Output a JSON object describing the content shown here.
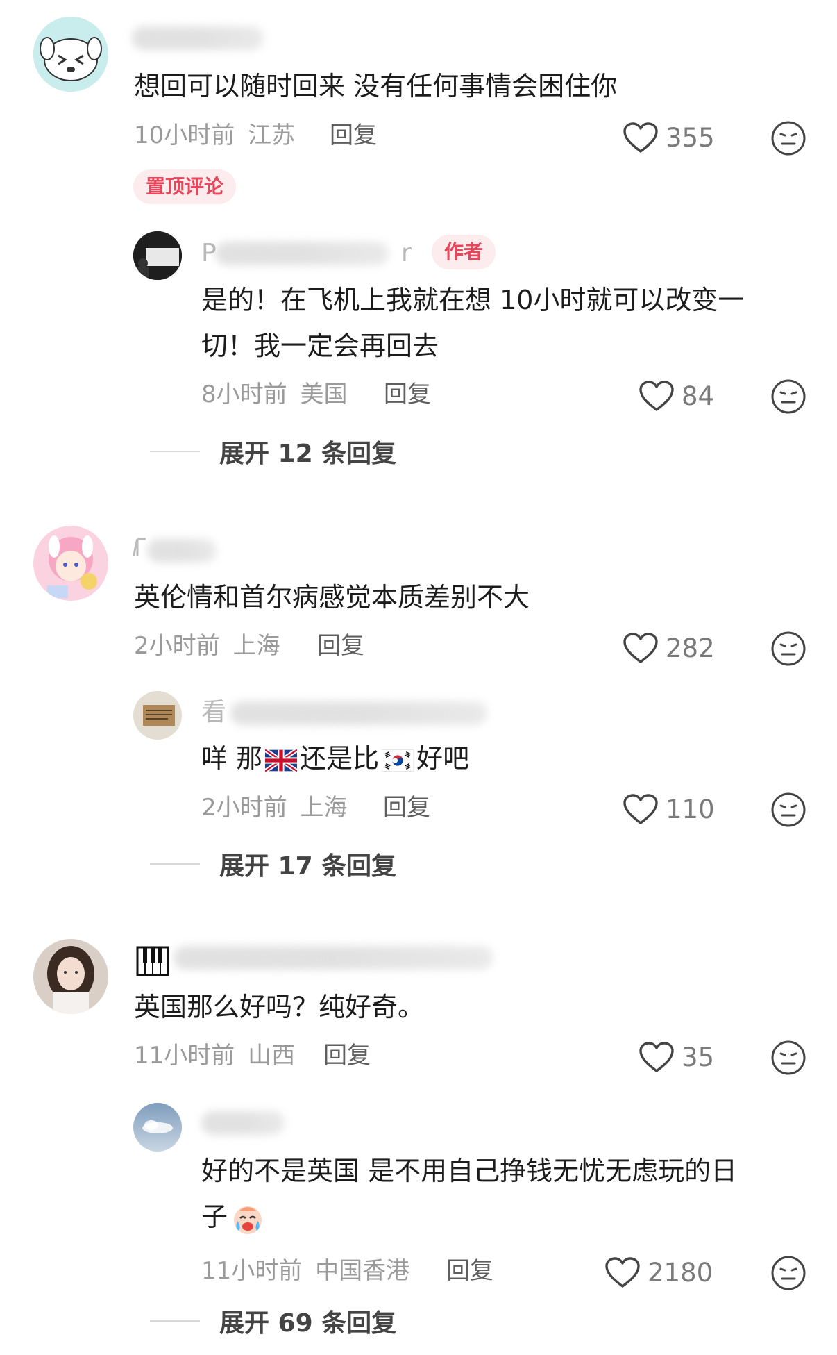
{
  "comments": [
    {
      "text": "想回可以随时回来 没有任何事情会困住你",
      "time": "10小时前",
      "location": "江苏",
      "reply_label": "回复",
      "likes": "355",
      "badge": "置顶评论",
      "reply": {
        "name_lead": "P",
        "name_tail": "r",
        "author_badge": "作者",
        "text_line1": "是的！在飞机上我就在想 10小时就可以改变一",
        "text_line2": "切！我一定会再回去",
        "time": "8小时前",
        "location": "美国",
        "reply_label": "回复",
        "likes": "84"
      },
      "expand_label": "展开 12 条回复"
    },
    {
      "text": "英伦情和首尔病感觉本质差别不大",
      "time": "2小时前",
      "location": "上海",
      "reply_label": "回复",
      "likes": "282",
      "reply": {
        "name_lead": "看",
        "text_part1": "咩 那",
        "text_part2": "还是比",
        "text_part3": "好吧",
        "time": "2小时前",
        "location": "上海",
        "reply_label": "回复",
        "likes": "110"
      },
      "expand_label": "展开 17 条回复"
    },
    {
      "text": "英国那么好吗？纯好奇。",
      "time": "11小时前",
      "location": "山西",
      "reply_label": "回复",
      "likes": "35",
      "reply": {
        "text_line1": "好的不是英国 是不用自己挣钱无忧无虑玩的日",
        "text_line2": "子",
        "time": "11小时前",
        "location": "中国香港",
        "reply_label": "回复",
        "likes": "2180"
      },
      "expand_label": "展开 69 条回复"
    }
  ],
  "colors": {
    "badge_text": "#e8465a",
    "badge_bg": "#fdecee",
    "meta": "#9a9a9a",
    "text": "#1c1c1c"
  },
  "icons": [
    "heart-icon",
    "dislike-face-icon",
    "uk-flag-icon",
    "korea-flag-icon",
    "crying-emoji-icon",
    "piano-icon"
  ]
}
